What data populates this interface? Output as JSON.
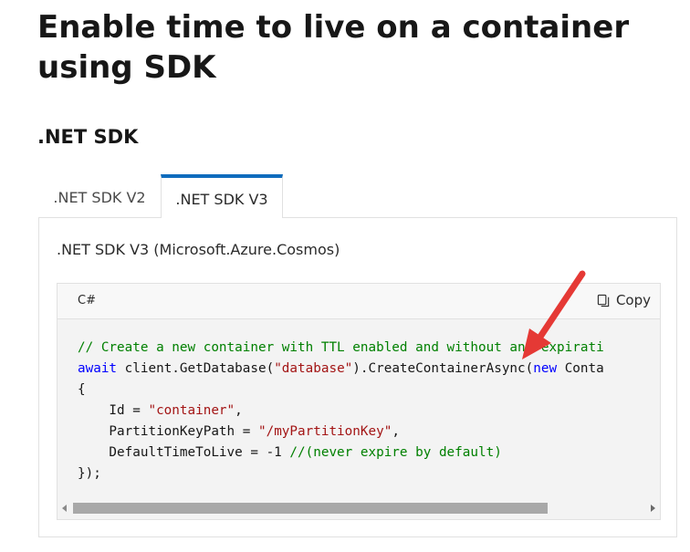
{
  "page": {
    "title": "Enable time to live on a container using SDK",
    "section_title": ".NET SDK"
  },
  "tabs": [
    {
      "label": ".NET SDK V2",
      "selected": false
    },
    {
      "label": ".NET SDK V3",
      "selected": true
    }
  ],
  "panel": {
    "heading": ".NET SDK V3 (Microsoft.Azure.Cosmos)"
  },
  "code": {
    "language": "C#",
    "copy_label": "Copy",
    "copy_icon": "copy-icon",
    "scroll_thumb_fraction": 0.83,
    "lines": {
      "l1_comment": "// Create a new container with TTL enabled and without any expirati",
      "l2_kw_await": "await",
      "l2_a": " client.GetDatabase(",
      "l2_str": "\"database\"",
      "l2_b": ").CreateContainerAsync(",
      "l2_kw_new": "new",
      "l2_c": " Conta",
      "l3": "{",
      "l4_a": "    Id = ",
      "l4_str": "\"container\"",
      "l4_b": ",",
      "l5_a": "    PartitionKeyPath = ",
      "l5_str": "\"/myPartitionKey\"",
      "l5_b": ",",
      "l6_a": "    DefaultTimeToLive = -1 ",
      "l6_comment": "//(never expire by default)",
      "l7": "});"
    }
  },
  "colors": {
    "accent": "#0f6cbd",
    "comment": "#008000",
    "string": "#a31515",
    "keyword": "#0000ff",
    "annotation_arrow": "#e53935"
  }
}
